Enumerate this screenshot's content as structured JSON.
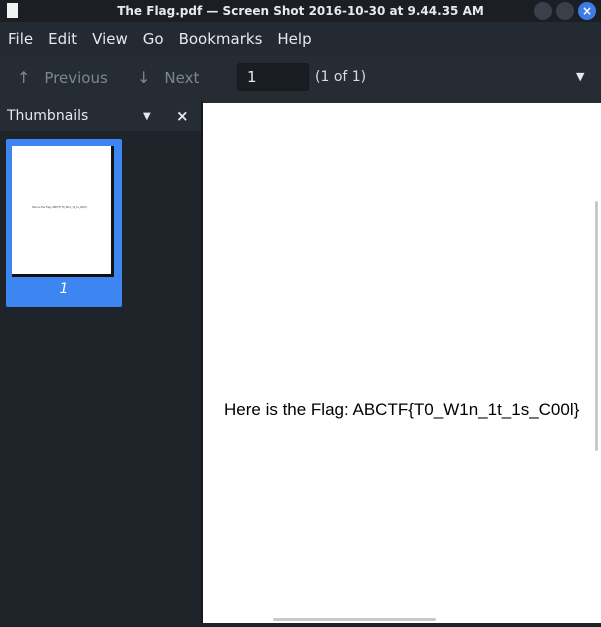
{
  "window": {
    "title": "The Flag.pdf — Screen Shot 2016-10-30 at 9.44.35 AM",
    "close_glyph": "×"
  },
  "menu": [
    "File",
    "Edit",
    "View",
    "Go",
    "Bookmarks",
    "Help"
  ],
  "toolbar": {
    "previous_label": "Previous",
    "previous_icon": "↑",
    "next_label": "Next",
    "next_icon": "↓",
    "page_value": "1",
    "page_count": "(1 of 1)",
    "menu_icon": "▼"
  },
  "sidebar": {
    "title": "Thumbnails",
    "chevron": "▼",
    "close": "×",
    "thumbnail_label": "1",
    "thumbnail_text": "Here is the Flag: ABCTF{T0_W1n_1t_1s_C00l}"
  },
  "document": {
    "text": "Here is the Flag: ABCTF{T0_W1n_1t_1s_C00l}"
  },
  "colors": {
    "accent": "#3d85f0",
    "background": "#1e2329",
    "close_button": "#3d7be6"
  }
}
